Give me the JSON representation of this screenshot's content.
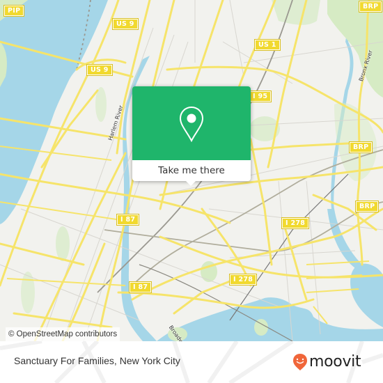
{
  "map": {
    "road_shields": [
      {
        "id": "pip",
        "label": "PIP"
      },
      {
        "id": "us9-top",
        "label": "US 9"
      },
      {
        "id": "us9-mid",
        "label": "US 9"
      },
      {
        "id": "us1",
        "label": "US 1"
      },
      {
        "id": "i95",
        "label": "I 95"
      },
      {
        "id": "brp-top",
        "label": "BRP"
      },
      {
        "id": "brp-mid",
        "label": "BRP"
      },
      {
        "id": "brp-low",
        "label": "BRP"
      },
      {
        "id": "i87-top",
        "label": "I 87"
      },
      {
        "id": "i87-low",
        "label": "I 87"
      },
      {
        "id": "i278-right",
        "label": "I 278"
      },
      {
        "id": "i278-low",
        "label": "I 278"
      }
    ],
    "water_labels": [
      {
        "id": "harlem-river",
        "label": "Harlem River"
      },
      {
        "id": "bronx-river",
        "label": "Bronx River"
      }
    ],
    "street_labels": [
      {
        "id": "broadway",
        "label": "Broadway"
      }
    ],
    "attribution": "© OpenStreetMap contributors",
    "colors": {
      "water": "#a5d6e8",
      "land": "#f2f2ee",
      "park": "#d6ebc4",
      "road": "#f6e46a",
      "shield": "#f1d92f"
    }
  },
  "popup": {
    "icon": "location-pin-icon",
    "button_label": "Take me there",
    "accent_color": "#1fb56b"
  },
  "footer": {
    "title": "Sanctuary For Families, New York City",
    "logo_text": "moovit",
    "logo_color": "#f0663a"
  }
}
